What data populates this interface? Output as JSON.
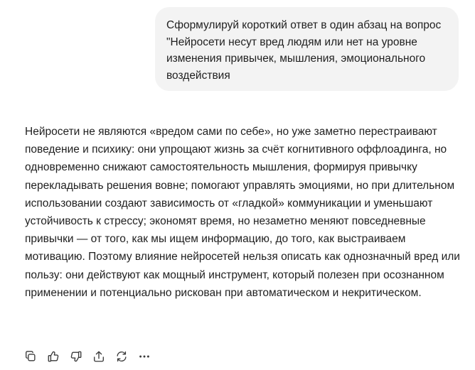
{
  "conversation": {
    "user_message": "Сформулируй короткий ответ в один абзац на вопрос \"Нейросети несут вред людям или нет на уровне изменения привычек, мышления, эмоционального воздействия",
    "assistant_message": "Нейросети не являются «вредом сами по себе», но уже заметно перестраивают поведение и психику: они упрощают жизнь за счёт когнитивного оффлоадинга, но одновременно снижают самостоятельность мышления, формируя привычку перекладывать решения вовне; помогают управлять эмоциями, но при длительном использовании создают зависимость от «гладкой» коммуникации и уменьшают устойчивость к стрессу; экономят время, но незаметно меняют повседневные привычки — от того, как мы ищем информацию, до того, как выстраиваем мотивацию. Поэтому влияние нейросетей нельзя описать как однозначный вред или пользу: они действуют как мощный инструмент, который полезен при осознанном применении и потенциально рискован при автоматическом и некритическом."
  },
  "actions": [
    {
      "name": "copy",
      "icon": "copy-icon"
    },
    {
      "name": "like",
      "icon": "thumbs-up-icon"
    },
    {
      "name": "dislike",
      "icon": "thumbs-down-icon"
    },
    {
      "name": "share",
      "icon": "share-icon"
    },
    {
      "name": "regenerate",
      "icon": "refresh-icon"
    },
    {
      "name": "more",
      "icon": "more-icon"
    }
  ],
  "colors": {
    "user_bubble_bg": "#f3f3f3",
    "text": "#1f1f1f",
    "icon": "#3a3a3a"
  }
}
